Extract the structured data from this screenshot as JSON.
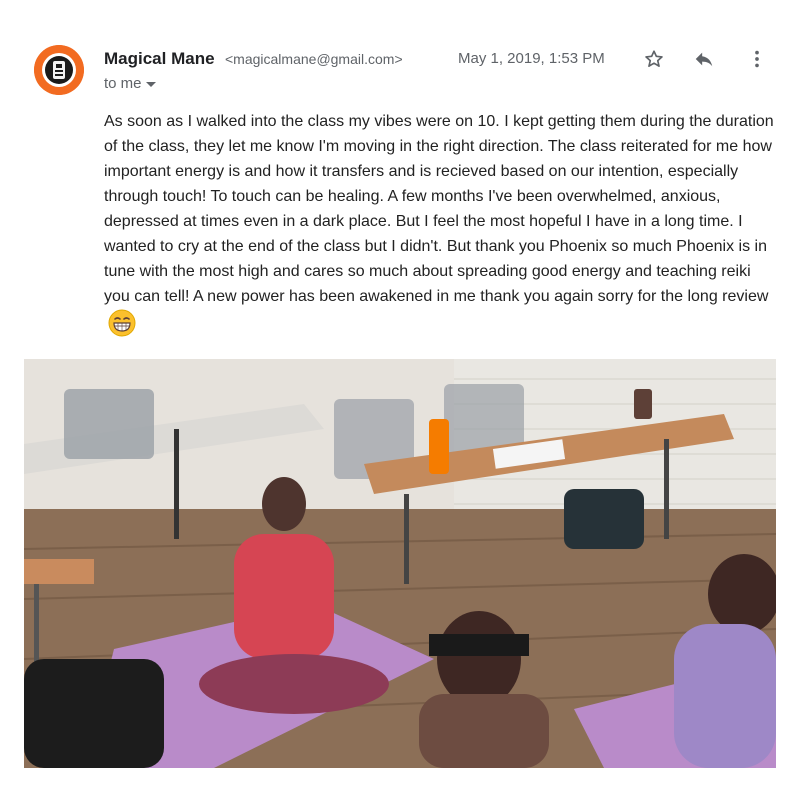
{
  "email": {
    "sender_name": "Magical Mane",
    "sender_email": "<magicalmane@gmail.com>",
    "date": "May 1, 2019, 1:53 PM",
    "recipient": "to me",
    "body": "As soon as I walked into the class my vibes were on 10. I kept getting them during the duration of the class, they let me know I'm moving in the right direction. The class reiterated for me how important energy is and how it transfers and is recieved based on our intention, especially through touch! To touch can be healing. A few months I've been overwhelmed, anxious, depressed at times even in a dark place. But I feel the most hopeful I have in a long time. I wanted to cry at the end of the class but I didn't. But thank you Phoenix so much Phoenix is in tune with the most high and cares so much about spreading good energy and teaching reiki you can tell! A new power has been awakened in me thank you again  sorry for the long review"
  },
  "icons": {
    "avatar": "avatar-logo",
    "star": "star-icon",
    "reply": "reply-icon",
    "more": "more-vert-icon",
    "emoji": "grinning-emoji"
  },
  "colors": {
    "avatar_bg": "#f26b21",
    "text_secondary": "#5f6368",
    "text_primary": "#202124"
  }
}
